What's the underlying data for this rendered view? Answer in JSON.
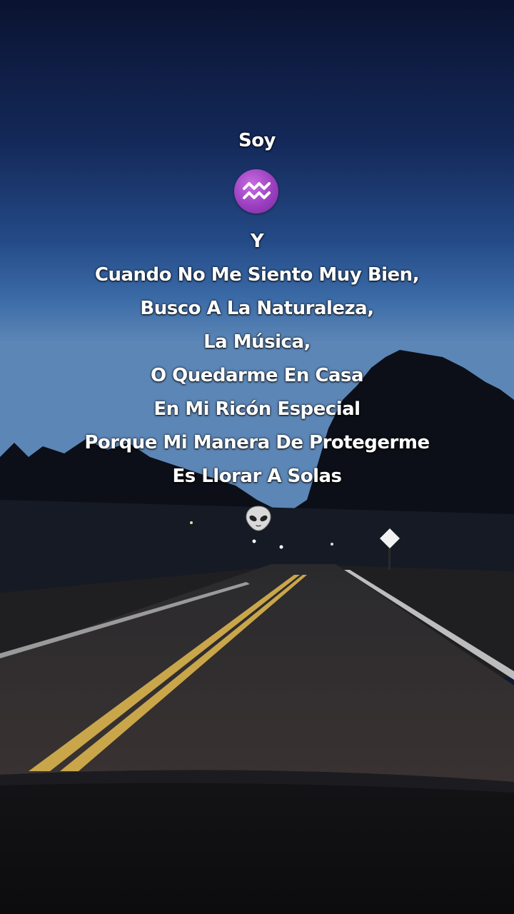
{
  "overlay": {
    "lines": [
      "Soy",
      "Y",
      "Cuando No Me Siento Muy Bien,",
      "Busco A La Naturaleza,",
      "La Música,",
      "O Quedarme En Casa",
      "En Mi Ricón Especial",
      "Porque Mi Manera De Protegerme",
      "Es Llorar A Solas"
    ],
    "zodiac_icon": "aquarius-icon",
    "end_icon": "alien-icon"
  },
  "colors": {
    "sky_top": "#0a1530",
    "sky_horizon": "#3f6a9e",
    "zodiac_purple": "#9b3fc0"
  }
}
